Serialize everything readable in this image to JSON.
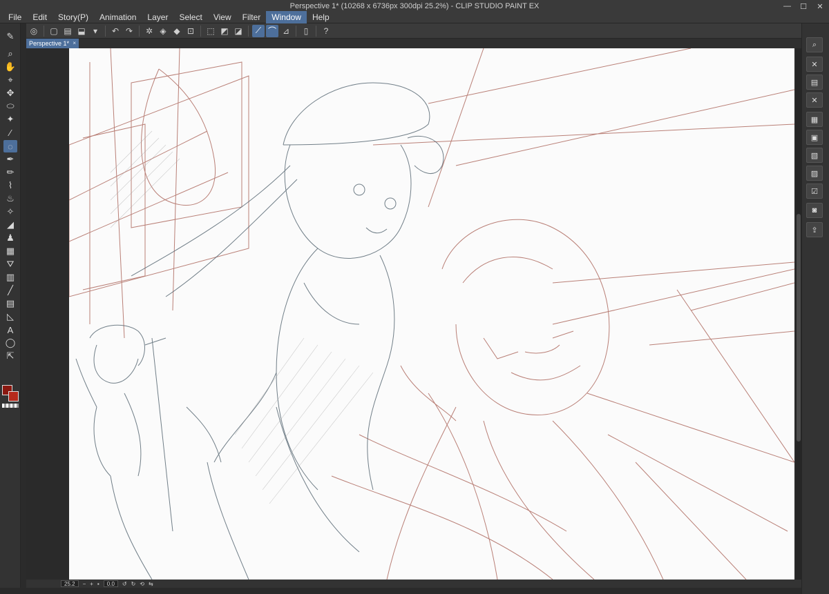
{
  "window": {
    "title": "Perspective 1* (10268 x 6736px 300dpi 25.2%)  - CLIP STUDIO PAINT EX"
  },
  "menu": {
    "items": [
      "File",
      "Edit",
      "Story(P)",
      "Animation",
      "Layer",
      "Select",
      "View",
      "Filter",
      "Window",
      "Help"
    ],
    "active": "Window"
  },
  "document": {
    "tab_label": "Perspective 1*",
    "tab_close": "×"
  },
  "status": {
    "zoom": "25.2",
    "rotation": "0.0"
  },
  "colors": {
    "main": "#8a1810",
    "sub": "#b52a1c",
    "accent": "#4d6f9b"
  }
}
